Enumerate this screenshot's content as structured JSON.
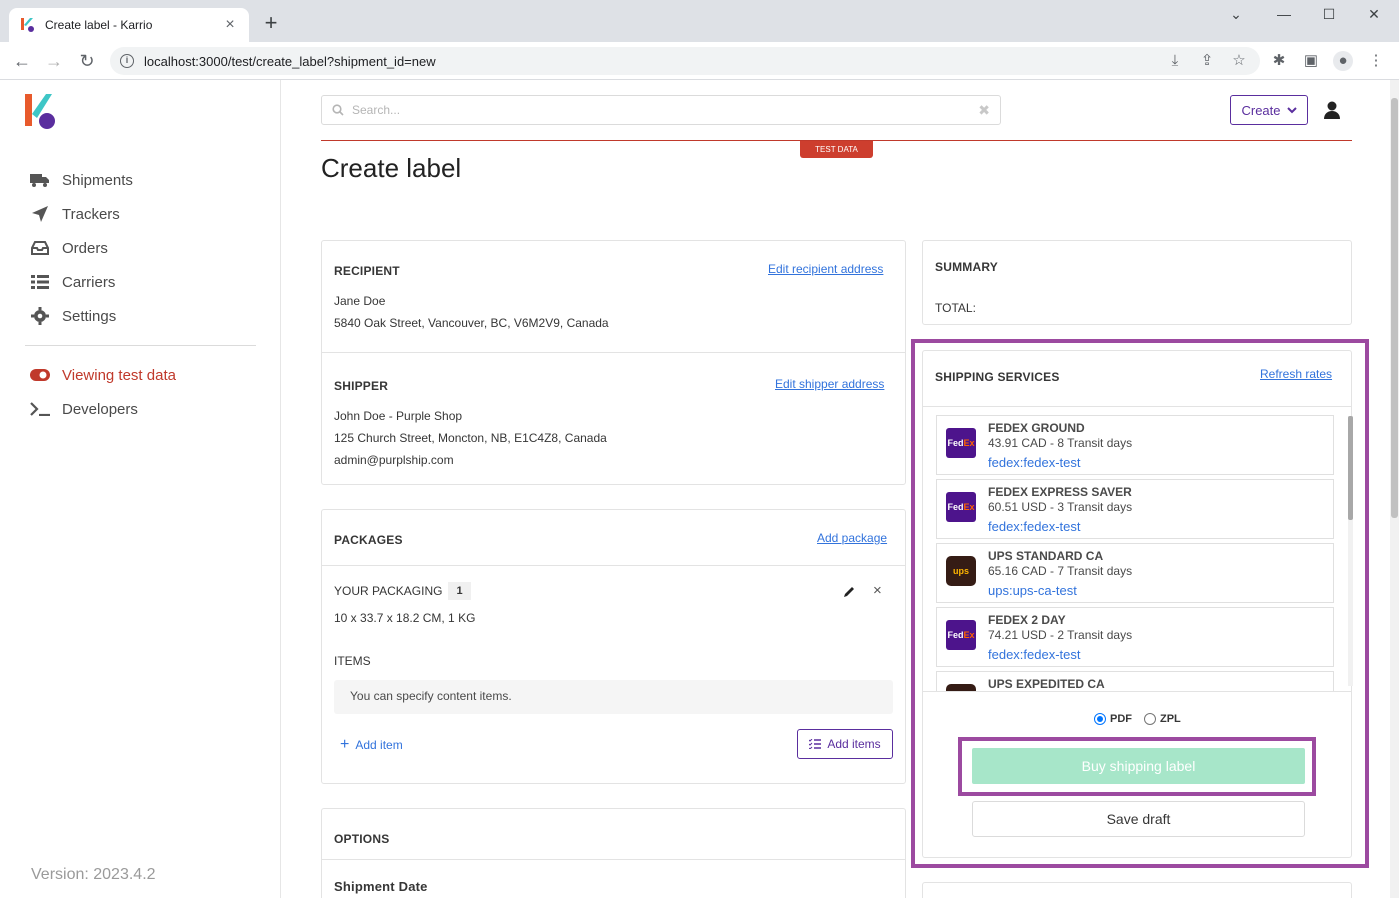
{
  "browser": {
    "tab_title": "Create label - Karrio",
    "url": "localhost:3000/test/create_label?shipment_id=new"
  },
  "sidebar": {
    "items": [
      {
        "label": "Shipments",
        "icon": "truck-icon"
      },
      {
        "label": "Trackers",
        "icon": "paper-plane-icon"
      },
      {
        "label": "Orders",
        "icon": "inbox-icon"
      },
      {
        "label": "Carriers",
        "icon": "list-icon"
      },
      {
        "label": "Settings",
        "icon": "gear-icon"
      }
    ],
    "test_mode_label": "Viewing test data",
    "developers_label": "Developers",
    "version": "Version: 2023.4.2"
  },
  "header": {
    "search_placeholder": "Search...",
    "create_label": "Create",
    "test_badge": "TEST DATA"
  },
  "page_title": "Create label",
  "recipient": {
    "title": "RECIPIENT",
    "edit_link": "Edit recipient address",
    "name": "Jane Doe",
    "address": "5840 Oak Street, Vancouver, BC, V6M2V9, Canada"
  },
  "shipper": {
    "title": "SHIPPER",
    "edit_link": "Edit shipper address",
    "name": "John Doe - Purple Shop",
    "address": "125 Church Street, Moncton, NB, E1C4Z8, Canada",
    "email": "admin@purplship.com"
  },
  "packages": {
    "title": "PACKAGES",
    "add_link": "Add package",
    "package_name": "YOUR PACKAGING",
    "quantity": "1",
    "dimensions": "10 x 33.7 x 18.2 CM, 1 KG",
    "items_title": "ITEMS",
    "items_hint": "You can specify content items.",
    "add_item": "Add item",
    "add_items": "Add items"
  },
  "options": {
    "title": "OPTIONS",
    "shipment_date_label": "Shipment Date"
  },
  "summary": {
    "title": "SUMMARY",
    "total_label": "TOTAL:"
  },
  "shipping_services": {
    "title": "SHIPPING SERVICES",
    "refresh": "Refresh rates",
    "rates": [
      {
        "name": "FEDEX GROUND",
        "meta": "43.91 CAD - 8 Transit days",
        "carrier": "fedex:fedex-test",
        "logo": "fedex"
      },
      {
        "name": "FEDEX EXPRESS SAVER",
        "meta": "60.51 USD - 3 Transit days",
        "carrier": "fedex:fedex-test",
        "logo": "fedex"
      },
      {
        "name": "UPS STANDARD CA",
        "meta": "65.16 CAD - 7 Transit days",
        "carrier": "ups:ups-ca-test",
        "logo": "ups"
      },
      {
        "name": "FEDEX 2 DAY",
        "meta": "74.21 USD - 2 Transit days",
        "carrier": "fedex:fedex-test",
        "logo": "fedex"
      },
      {
        "name": "UPS EXPEDITED CA",
        "meta": "",
        "carrier": "",
        "logo": "ups"
      }
    ],
    "format_pdf": "PDF",
    "format_zpl": "ZPL",
    "selected_format": "PDF",
    "buy_label": "Buy shipping label",
    "save_draft": "Save draft"
  },
  "colors": {
    "accent": "#5a2e9e",
    "link": "#3273dc",
    "test_red": "#cd3e2e",
    "buy_button": "#a7e6c9",
    "highlight": "#9c4aa0"
  }
}
